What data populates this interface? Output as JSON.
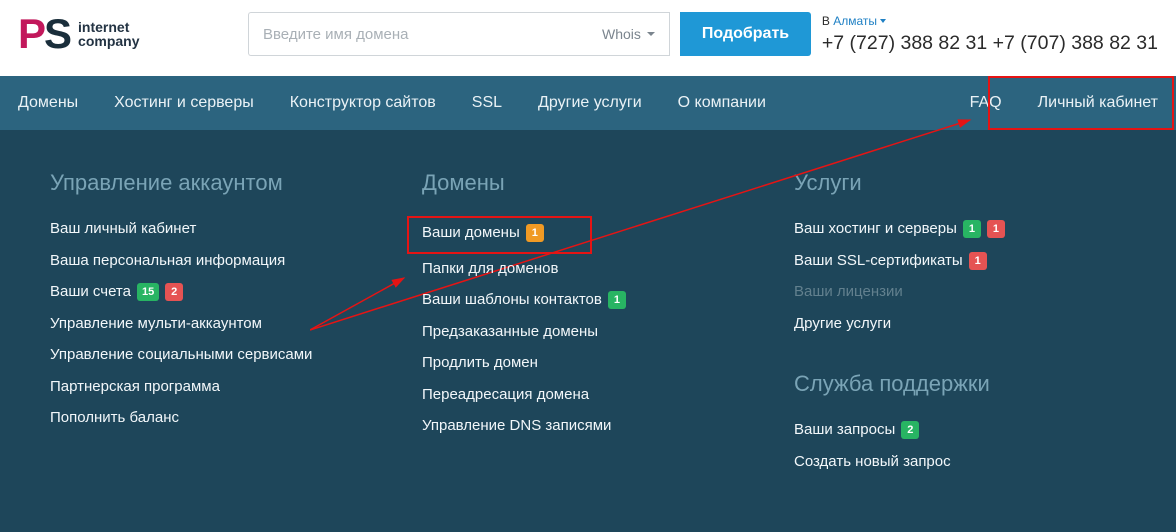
{
  "header": {
    "logo": {
      "line1": "internet",
      "line2": "company"
    },
    "search": {
      "placeholder": "Введите имя домена",
      "whois_label": "Whois",
      "button": "Подобрать"
    },
    "city_prefix": "В ",
    "city": "Алматы",
    "phone1": "+7 (727) 388 82 31",
    "phone2": "+7 (707) 388 82 31"
  },
  "nav": {
    "items": [
      "Домены",
      "Хостинг и серверы",
      "Конструктор сайтов",
      "SSL",
      "Другие услуги",
      "О компании",
      "FAQ",
      "Личный кабинет"
    ]
  },
  "mega": {
    "col1": {
      "title": "Управление аккаунтом",
      "items": [
        {
          "label": "Ваш личный кабинет"
        },
        {
          "label": "Ваша персональная информация"
        },
        {
          "label": "Ваши счета",
          "badges": [
            {
              "text": "15",
              "color": "green"
            },
            {
              "text": "2",
              "color": "red"
            }
          ]
        },
        {
          "label": "Управление мульти-аккаунтом"
        },
        {
          "label": "Управление социальными сервисами"
        },
        {
          "label": "Партнерская программа"
        },
        {
          "label": "Пополнить баланс"
        }
      ]
    },
    "col2": {
      "title": "Домены",
      "items": [
        {
          "label": "Ваши домены",
          "badges": [
            {
              "text": "1",
              "color": "orange"
            }
          ]
        },
        {
          "label": "Папки для доменов"
        },
        {
          "label": "Ваши шаблоны контактов",
          "badges": [
            {
              "text": "1",
              "color": "green"
            }
          ]
        },
        {
          "label": "Предзаказанные домены"
        },
        {
          "label": "Продлить домен"
        },
        {
          "label": "Переадресация домена"
        },
        {
          "label": "Управление DNS записями"
        }
      ]
    },
    "col3": {
      "title": "Услуги",
      "items": [
        {
          "label": "Ваш хостинг и серверы",
          "badges": [
            {
              "text": "1",
              "color": "green"
            },
            {
              "text": "1",
              "color": "red"
            }
          ]
        },
        {
          "label": "Ваши SSL-сертификаты",
          "badges": [
            {
              "text": "1",
              "color": "red"
            }
          ]
        },
        {
          "label": "Ваши лицензии",
          "disabled": true
        },
        {
          "label": "Другие услуги"
        }
      ],
      "section2_title": "Служба поддержки",
      "section2_items": [
        {
          "label": "Ваши запросы",
          "badges": [
            {
              "text": "2",
              "color": "green"
            }
          ]
        },
        {
          "label": "Создать новый запрос"
        }
      ]
    }
  }
}
